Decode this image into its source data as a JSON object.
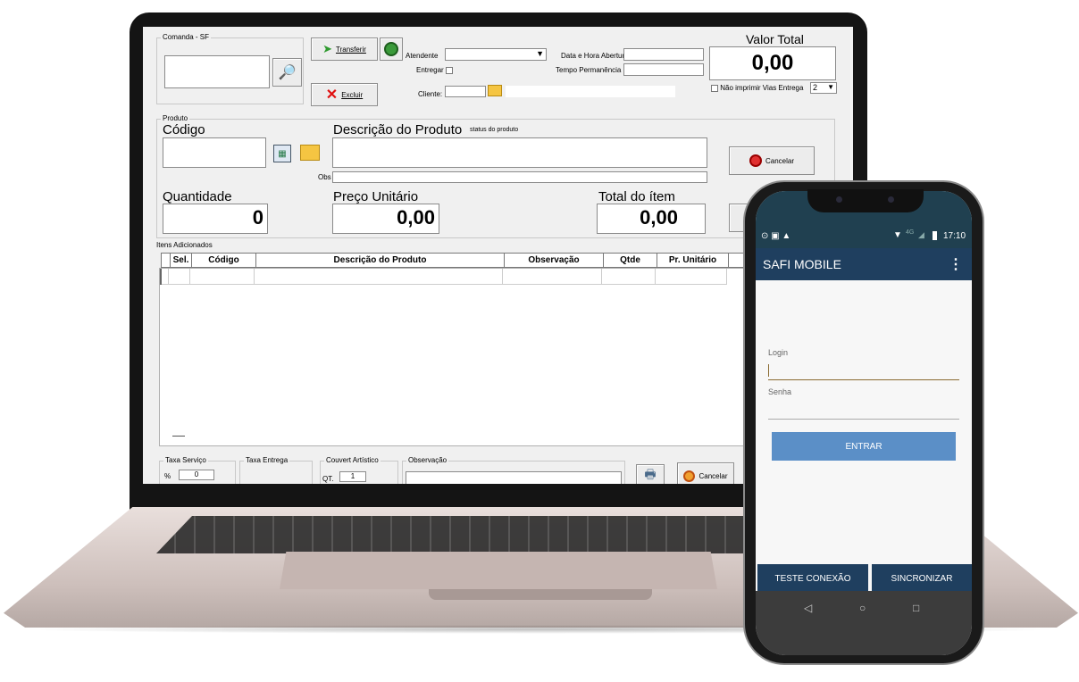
{
  "desktop": {
    "comanda_label": "Comanda - SF",
    "transferir": "Transferir",
    "excluir": "Excluir",
    "atendente_label": "Atendente",
    "entregar_label": "Entregar",
    "cliente_label": "Cliente:",
    "data_hora_label": "Data e Hora Abertura",
    "tempo_label": "Tempo Permanência",
    "valor_total_label": "Valor Total",
    "valor_total": "0,00",
    "nao_imprimir_label": "Não imprimir Vias Entrega",
    "vias_value": "2",
    "produto_group": "Produto",
    "codigo_label": "Código",
    "descricao_label": "Descrição do Produto",
    "status_label": "status do produto",
    "obs_label": "Obs",
    "cancelar": "Cancelar",
    "quantidade_label": "Quantidade",
    "quantidade": "0",
    "preco_label": "Preço Unitário",
    "preco": "0,00",
    "total_item_label": "Total do ítem",
    "total_item": "0,00",
    "itens_group": "Itens Adicionados",
    "columns": [
      "Sel.",
      "Código",
      "Descrição do Produto",
      "Observação",
      "Qtde",
      "Pr. Unitário",
      ""
    ],
    "taxa_servico_label": "Taxa Serviço",
    "taxa_pct_symbol": "%",
    "taxa_servico_value": "0",
    "taxa_entrega_label": "Taxa Entrega",
    "couvert_label": "Couvert Artístico",
    "qt_label": "QT.",
    "couvert_qt": "1",
    "observacao_label": "Observação",
    "cancelar_bottom": "Cancelar"
  },
  "phone": {
    "status_icons_left": "⊙ ▣ ▲",
    "status_network": "4G",
    "time": "17:10",
    "app_title": "SAFI MOBILE",
    "menu_icon": "⋮",
    "login_label": "Login",
    "senha_label": "Senha",
    "entrar": "ENTRAR",
    "teste_conexao": "TESTE CONEXÃO",
    "sincronizar": "SINCRONIZAR",
    "nav_back": "◁",
    "nav_home": "○",
    "nav_recent": "□"
  },
  "colors": {
    "phone_appbar": "#1f3f5f",
    "phone_button": "#5b8fc7",
    "phone_bottom_button": "#1f3f5f"
  }
}
